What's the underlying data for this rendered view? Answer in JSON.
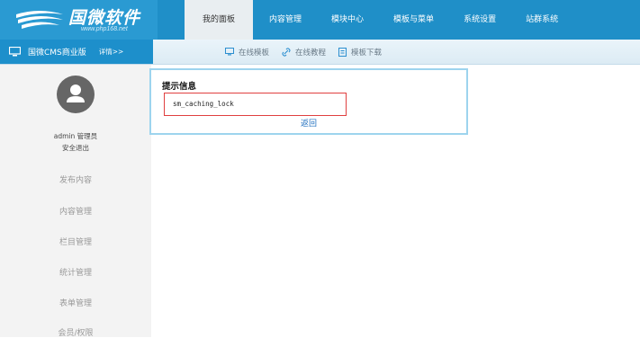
{
  "logo": {
    "title": "国微软件",
    "subtitle": "www.php168.net"
  },
  "nav": [
    {
      "label": "我的面板",
      "active": true
    },
    {
      "label": "内容管理"
    },
    {
      "label": "模块中心"
    },
    {
      "label": "模板与菜单"
    },
    {
      "label": "系统设置"
    },
    {
      "label": "站群系统"
    }
  ],
  "subbar": {
    "brand": "国微CMS商业版",
    "detail": "详情>>",
    "links": [
      {
        "label": "在线模板",
        "icon": "monitor-icon"
      },
      {
        "label": "在线教程",
        "icon": "link-icon"
      },
      {
        "label": "模板下载",
        "icon": "document-icon"
      }
    ]
  },
  "sidebar": {
    "username": "admin 管理员",
    "logout": "安全退出",
    "items": [
      "发布内容",
      "内容管理",
      "栏目管理",
      "统计管理",
      "表单管理",
      "会员/权限"
    ]
  },
  "message": {
    "title": "提示信息",
    "content": "sm_caching_lock",
    "back": "返回"
  },
  "colors": {
    "topbar": "#1f8fc8",
    "sidebar": "#f3f3f3",
    "box_border": "#9dd4ee",
    "error_border": "#e04040"
  }
}
